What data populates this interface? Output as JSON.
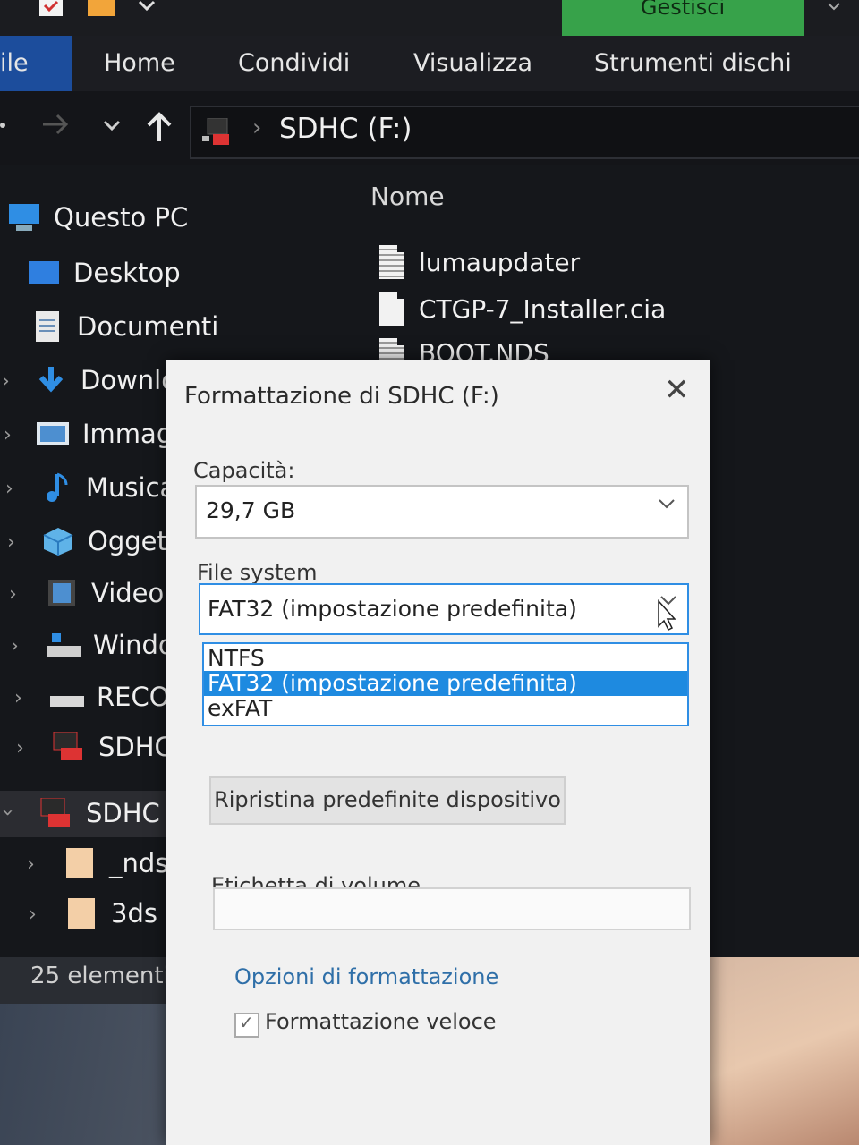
{
  "topbar": {
    "manage_tab": "Gestisci",
    "icons": [
      "checklist-icon",
      "folder-icon",
      "quick-access-dropdown-icon"
    ]
  },
  "ribbon": {
    "tabs": [
      "ile",
      "Home",
      "Condividi",
      "Visualizza",
      "Strumenti dischi"
    ]
  },
  "address": {
    "path": "SDHC (F:)"
  },
  "navpane": {
    "items": [
      {
        "label": "Questo PC",
        "icon": "pc-icon"
      },
      {
        "label": "Desktop",
        "icon": "desktop-icon"
      },
      {
        "label": "Documenti",
        "icon": "documents-icon"
      },
      {
        "label": "Downlo",
        "icon": "download-icon"
      },
      {
        "label": "Immag",
        "icon": "images-icon"
      },
      {
        "label": "Musica",
        "icon": "music-icon"
      },
      {
        "label": "Oggett",
        "icon": "3d-objects-icon"
      },
      {
        "label": "Video",
        "icon": "video-icon"
      },
      {
        "label": "Windo",
        "icon": "windows-drive-icon"
      },
      {
        "label": "RECOV",
        "icon": "drive-icon"
      },
      {
        "label": "SDHC (",
        "icon": "sd-card-icon"
      },
      {
        "label": "SDHC (F:",
        "icon": "sd-card-icon"
      },
      {
        "label": "_nds",
        "icon": "folder-icon"
      },
      {
        "label": "3ds",
        "icon": "folder-icon"
      }
    ]
  },
  "filelist": {
    "column_name": "Nome",
    "files": [
      "lumaupdater",
      "CTGP-7_Installer.cia",
      "BOOT.NDS"
    ]
  },
  "status": {
    "count": "25 elementi",
    "separator": "|"
  },
  "dialog": {
    "title": "Formattazione di SDHC (F:)",
    "close_glyph": "✕",
    "capacity_label": "Capacità:",
    "capacity_value": "29,7 GB",
    "filesystem_label": "File system",
    "filesystem_value": "FAT32 (impostazione predefinita)",
    "filesystem_options": [
      "NTFS",
      "FAT32 (impostazione predefinita)",
      "exFAT"
    ],
    "filesystem_selected_index": 1,
    "restore_button": "Ripristina predefinite dispositivo",
    "volume_label": "Etichetta di volume",
    "volume_value": "",
    "format_options_label": "Opzioni di formattazione",
    "quick_format_label": "Formattazione veloce",
    "quick_format_checked": true
  }
}
